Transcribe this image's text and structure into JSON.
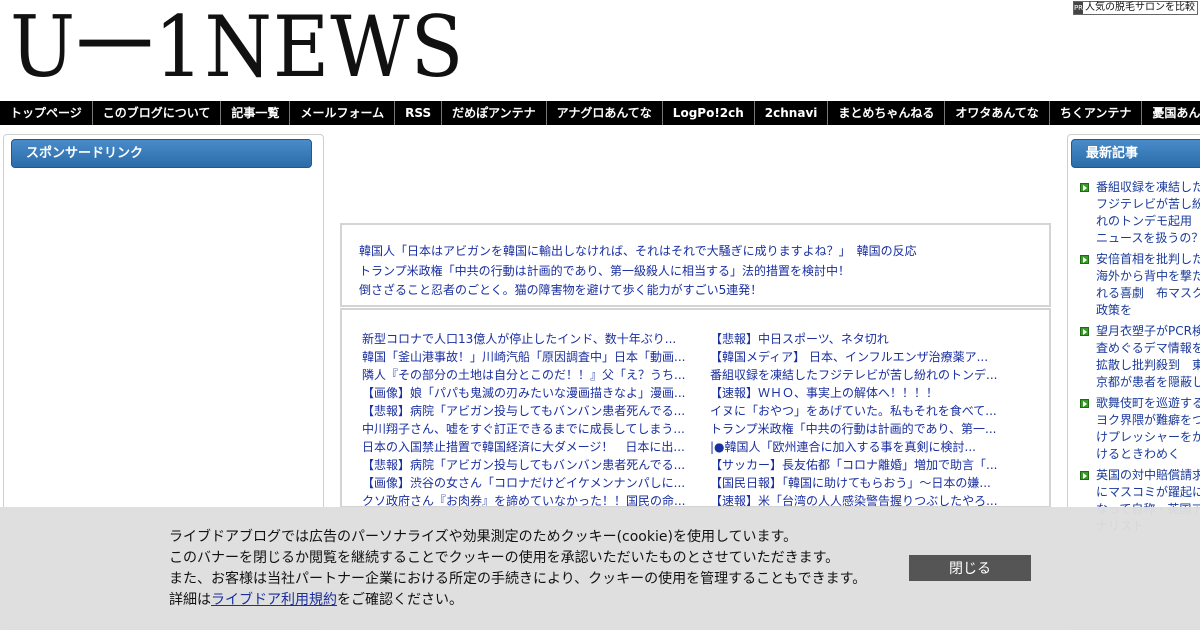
{
  "header": {
    "logo_text": "U一1NEWS",
    "ad_badge": "PR",
    "ad_link_text": "人気の脱毛サロンを比較"
  },
  "nav": {
    "items": [
      "トップページ",
      "このブログについて",
      "記事一覧",
      "メールフォーム",
      "RSS",
      "だめぽアンテナ",
      "アナグロあんてな",
      "LogPo!2ch",
      "2chnavi",
      "まとめちゃんねる",
      "オワタあんてな",
      "ちくアンテナ",
      "憂国あんてな"
    ]
  },
  "left_sidebar": {
    "title": "スポンサードリンク"
  },
  "featured_links": [
    "韓国人「日本はアビガンを韓国に輸出しなければ、それはそれで大騒ぎに成りますよね？」　韓国の反応",
    "トランプ米政権「中共の行動は計画的であり、第一級殺人に相当する」法的措置を検討中！",
    "倒さざること忍者のごとく。猫の障害物を避けて歩く能力がすごい5連発！"
  ],
  "articles": {
    "left": [
      "新型コロナで人口13億人が停止したインド、数十年ぶり...",
      "韓国「釜山港事故！」川崎汽船「原因調査中」日本「動画...",
      "隣人『その部分の土地は自分とこのだ！！』父「え？うち...",
      "【画像】娘「パパも鬼滅の刃みたいな漫画描きなよ」漫画...",
      "【悲報】病院「アビガン投与してもバンバン患者死んでる...",
      "中川翔子さん、嘘をすぐ訂正できるまでに成長してしまう...",
      "日本の入国禁止措置で韓国経済に大ダメージ！　日本に出...",
      "【悲報】病院「アビガン投与してもバンバン患者死んでる...",
      "【画像】渋谷の女さん「コロナだけどイケメンナンパしに...",
      "クソ政府さん『お肉券』を諦めていなかった！！国民の命..."
    ],
    "right": [
      "【悲報】中日スポーツ、ネタ切れ",
      "【韓国メディア】 日本、インフルエンザ治療薬ア...",
      "番組収録を凍結したフジテレビが苦し紛れのトンデ...",
      "【速報】ＷＨＯ、事実上の解体へ！！！！",
      "イヌに「おやつ」をあげていた。私もそれを食べて...",
      "トランプ米政権「中共の行動は計画的であり、第一...",
      "|●韓国人「欧州連合に加入する事を真剣に検討...",
      "【サッカー】長友佑都「コロナ離婚」増加で助言「...",
      "【国民日報】「韓国に助けてもらおう」～日本の嫌...",
      "【速報】米「台湾の人人感染警告握りつぶしたやろ..."
    ]
  },
  "right_sidebar": {
    "title": "最新記事",
    "items": [
      "番組収録を凍結したフジテレビが苦し紛れのトンデモ起用　ニュースを扱うの？",
      "安倍首相を批判した海外から背中を撃たれる喜劇　布マスク政策を",
      "望月衣塑子がPCR検査めぐるデマ情報を拡散し批判殺到　東京都が患者を隠蔽した？",
      "歌舞伎町を巡遊するヨク界隈が難癖をつけプレッシャーをかけるときわめく",
      "英国の対中賠償請求にマスコミが躍起になって自称・英国アナリスト"
    ]
  },
  "cookie_banner": {
    "line1": "ライブドアブログでは広告のパーソナライズや効果測定のためクッキー(cookie)を使用しています。",
    "line2": "このバナーを閉じるか閲覧を継続することでクッキーの使用を承認いただいたものとさせていただきます。",
    "line3": "また、お客様は当社パートナー企業における所定の手続きにより、クッキーの使用を管理することもできます。",
    "line4_prefix": "詳細は",
    "link_text": "ライブドア利用規約",
    "line4_suffix": "をご確認ください。",
    "close_label": "閉じる"
  },
  "colors": {
    "nav_bg": "#000000",
    "link": "#1a2fa0",
    "widget_title": "#2a6ba8",
    "bullet": "#3a9a2a",
    "close_button": "#555555"
  }
}
